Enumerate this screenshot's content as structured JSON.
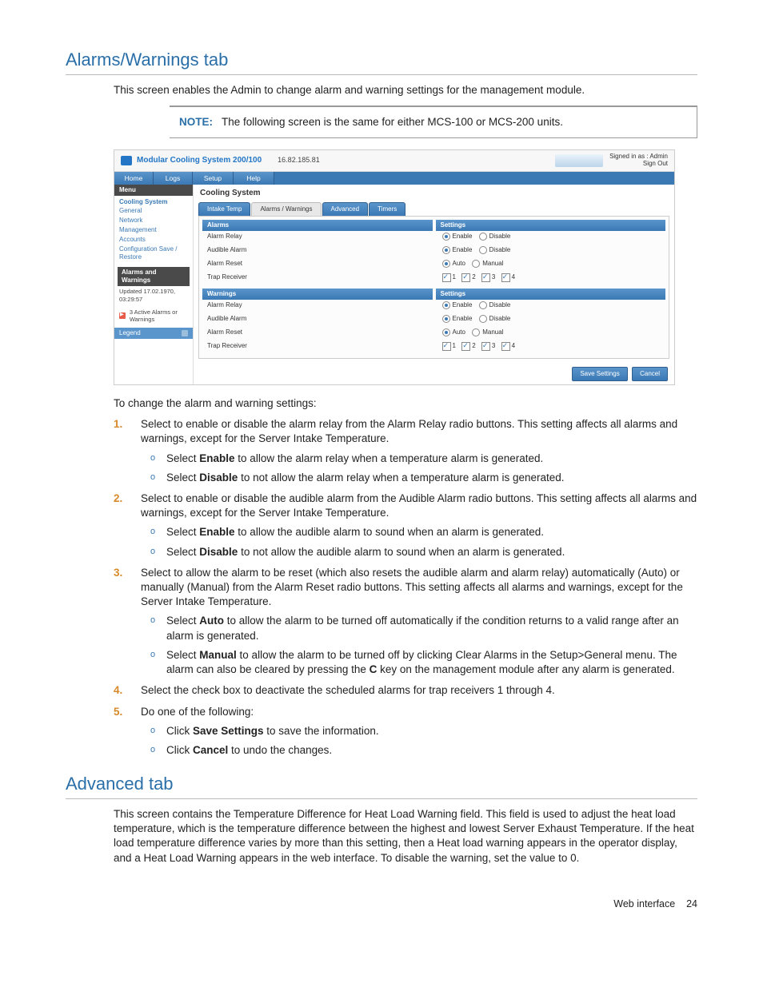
{
  "heading1": "Alarms/Warnings tab",
  "intro1": "This screen enables the Admin to change alarm and warning settings for the management module.",
  "note_label": "NOTE:",
  "note_text": "The following screen is the same for either MCS-100 or MCS-200 units.",
  "scr": {
    "product": "Modular Cooling System 200/100",
    "ip": "16.82.185.81",
    "sign_top": "Signed in as : Admin",
    "sign_bot": "Sign Out",
    "nav_home": "Home",
    "nav_logs": "Logs",
    "nav_setup": "Setup",
    "nav_help": "Help",
    "menu_h": "Menu",
    "menu_section": "Cooling System",
    "menu_items": [
      "General",
      "Network",
      "Management",
      "Accounts",
      "Configuration Save / Restore"
    ],
    "menu_aw": "Alarms and Warnings",
    "menu_updated": "Updated 17.02.1970, 03:29:57",
    "menu_alarmct": "3 Active Alarms or Warnings",
    "menu_legend": "Legend",
    "main_title": "Cooling System",
    "tab1": "Intake Temp",
    "tab2": "Alarms / Warnings",
    "tab3": "Advanced",
    "tab4": "Timers",
    "sec_alarms": "Alarms",
    "sec_warnings": "Warnings",
    "sec_settings": "Settings",
    "row_relay": "Alarm Relay",
    "row_audible": "Audible Alarm",
    "row_reset": "Alarm Reset",
    "row_trap": "Trap Receiver",
    "opt_enable": "Enable",
    "opt_disable": "Disable",
    "opt_auto": "Auto",
    "opt_manual": "Manual",
    "chk1": "1",
    "chk2": "2",
    "chk3": "3",
    "chk4": "4",
    "btn_save": "Save Settings",
    "btn_cancel": "Cancel"
  },
  "lead2": "To change the alarm and warning settings:",
  "step1": "Select to enable or disable the alarm relay from the Alarm Relay radio buttons. This setting affects all alarms and warnings, except for the Server Intake Temperature.",
  "step1a_pre": "Select ",
  "step1a_b": "Enable",
  "step1a_post": " to allow the alarm relay when a temperature alarm is generated.",
  "step1b_pre": "Select ",
  "step1b_b": "Disable",
  "step1b_post": " to not allow the alarm relay when a temperature alarm is generated.",
  "step2": "Select to enable or disable the audible alarm from the Audible Alarm radio buttons. This setting affects all alarms and warnings, except for the Server Intake Temperature.",
  "step2a_pre": "Select ",
  "step2a_b": "Enable",
  "step2a_post": " to allow the audible alarm to sound when an alarm is generated.",
  "step2b_pre": "Select ",
  "step2b_b": "Disable",
  "step2b_post": " to not allow the audible alarm to sound when an alarm is generated.",
  "step3": "Select to allow the alarm to be reset (which also resets the audible alarm and alarm relay) automatically (Auto) or manually (Manual) from the Alarm Reset radio buttons. This setting affects all alarms and warnings, except for the Server Intake Temperature.",
  "step3a_pre": "Select ",
  "step3a_b": "Auto",
  "step3a_post": " to allow the alarm to be turned off automatically if the condition returns to a valid range after an alarm is generated.",
  "step3b_pre": "Select ",
  "step3b_b": "Manual",
  "step3b_mid": " to allow the alarm to be turned off by clicking Clear Alarms in the Setup>General menu. The alarm can also be cleared by pressing the ",
  "step3b_key": "C",
  "step3b_post": " key on the management module after any alarm is generated.",
  "step4": "Select the check box to deactivate the scheduled alarms for trap receivers 1 through 4.",
  "step5": "Do one of the following:",
  "step5a_pre": "Click ",
  "step5a_b": "Save Settings",
  "step5a_post": " to save the information.",
  "step5b_pre": "Click ",
  "step5b_b": "Cancel",
  "step5b_post": " to undo the changes.",
  "heading2": "Advanced tab",
  "adv_p": "This screen contains the Temperature Difference for Heat Load Warning field. This field is used to adjust the heat load temperature, which is the temperature difference between the highest and lowest Server Exhaust Temperature. If the heat load temperature difference varies by more than this setting, then a Heat load warning appears in the operator display, and a Heat Load Warning appears in the web interface. To disable the warning, set the value to 0.",
  "footer_label": "Web interface",
  "footer_page": "24"
}
